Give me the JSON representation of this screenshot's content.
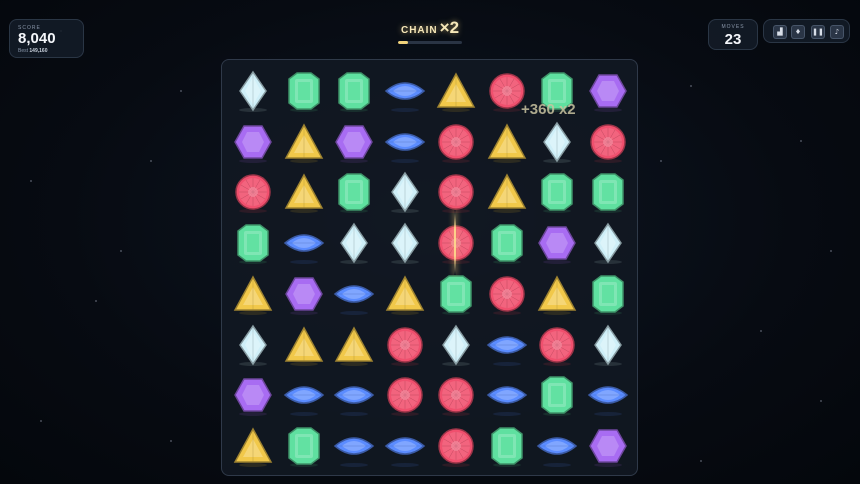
{
  "hud": {
    "score_label": "SCORE",
    "score_value": "8,040",
    "best_label": "Best",
    "best_value": "149,160",
    "chain_label": "CHAIN",
    "chain_multiplier": "×2",
    "chain_progress": 0.15,
    "moves_label": "MOVES",
    "moves_value": "23"
  },
  "toolbar": [
    {
      "name": "stats-button",
      "icon": "bar-chart-icon",
      "glyph": "▟"
    },
    {
      "name": "gems-button",
      "icon": "gem-icon",
      "glyph": "♦"
    },
    {
      "name": "pause-button",
      "icon": "pause-icon",
      "glyph": "❚❚"
    },
    {
      "name": "music-button",
      "icon": "music-note-icon",
      "glyph": "♪"
    }
  ],
  "popup": "+360 x2",
  "gem_colors": {
    "diamond": "#cfeff8",
    "emerald": "#5fe0a0",
    "sapphire": "#5b8cff",
    "topaz": "#f1c84a",
    "ruby": "#f0506e",
    "amethyst": "#a86cf2"
  },
  "board": [
    [
      "diamond",
      "emerald",
      "emerald",
      "sapphire",
      "topaz",
      "ruby",
      "emerald",
      "amethyst"
    ],
    [
      "amethyst",
      "topaz",
      "amethyst",
      "sapphire",
      "ruby",
      "topaz",
      "diamond",
      "ruby"
    ],
    [
      "ruby",
      "topaz",
      "emerald",
      "diamond",
      "ruby",
      "topaz",
      "emerald",
      "emerald"
    ],
    [
      "emerald",
      "sapphire",
      "diamond",
      "diamond",
      "ruby",
      "emerald",
      "amethyst",
      "diamond"
    ],
    [
      "topaz",
      "amethyst",
      "sapphire",
      "topaz",
      "emerald",
      "ruby",
      "topaz",
      "emerald"
    ],
    [
      "diamond",
      "topaz",
      "topaz",
      "ruby",
      "diamond",
      "sapphire",
      "ruby",
      "diamond"
    ],
    [
      "amethyst",
      "sapphire",
      "sapphire",
      "ruby",
      "ruby",
      "sapphire",
      "emerald",
      "sapphire"
    ],
    [
      "topaz",
      "emerald",
      "sapphire",
      "sapphire",
      "ruby",
      "emerald",
      "sapphire",
      "amethyst"
    ]
  ]
}
